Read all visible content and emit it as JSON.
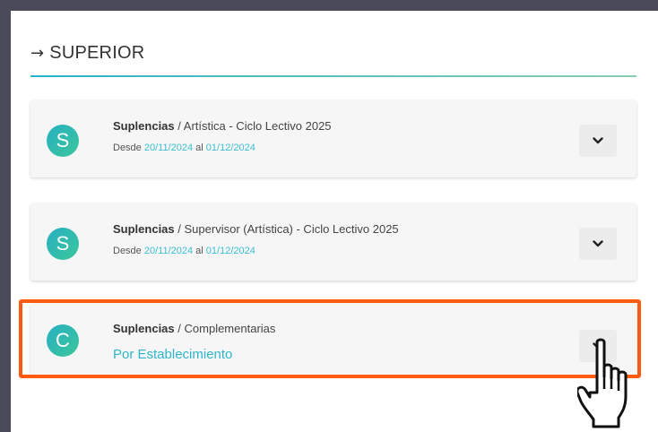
{
  "section": {
    "arrow_glyph": "→",
    "title": "SUPERIOR"
  },
  "cards": [
    {
      "avatar_letter": "S",
      "category": "Suplencias",
      "separator": "/",
      "name": "Artística - Ciclo Lectivo 2025",
      "desde_label": "Desde",
      "date_from": "20/11/2024",
      "al_label": "al",
      "date_to": "01/12/2024",
      "expand_icon": "chevron-down-icon"
    },
    {
      "avatar_letter": "S",
      "category": "Suplencias",
      "separator": "/",
      "name": "Supervisor (Artística) - Ciclo Lectivo 2025",
      "desde_label": "Desde",
      "date_from": "20/11/2024",
      "al_label": "al",
      "date_to": "01/12/2024",
      "expand_icon": "chevron-down-icon"
    },
    {
      "avatar_letter": "C",
      "category": "Suplencias",
      "separator": "/",
      "name": "Complementarias",
      "link_text": "Por Establecimiento",
      "expand_icon": "chevron-down-icon"
    }
  ],
  "colors": {
    "accent": "#2fb6c9",
    "highlight": "#ff5a12",
    "avatar_gradient_start": "#27b0c2",
    "avatar_gradient_end": "#3cc69b"
  }
}
